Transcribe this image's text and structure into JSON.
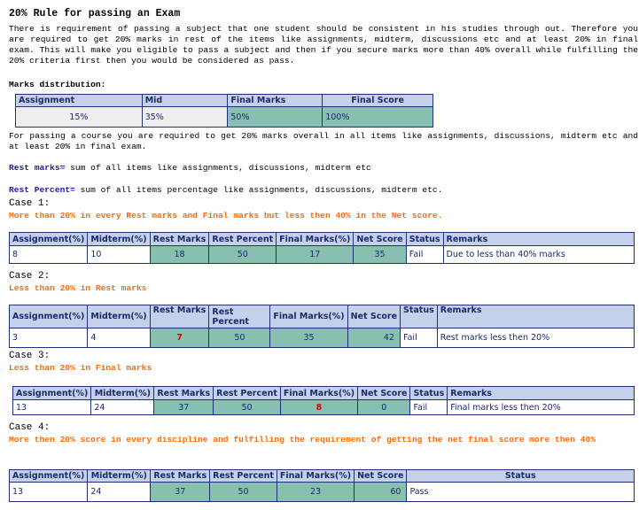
{
  "title": "20% Rule for passing an Exam",
  "intro": "There is requirement of passing a subject that one student should be consistent in his studies through out. Therefore you are required to get 20% marks in rest of the items like assignments, midterm, discussions etc and at least 20% in final exam. This will make you eligible to pass a subject and then if you secure marks more than 40% overall while fulfilling the 20% criteria first then you would be considered as pass.",
  "marks_heading": "Marks distribution:",
  "dist_table": {
    "headers": [
      "Assignment",
      "Mid",
      "Final Marks",
      "Final Score"
    ],
    "values": [
      "15%",
      "35%",
      "50%",
      "100%"
    ]
  },
  "passing_text": "For passing a course you are required to get 20% marks overall in all items like assignments, discussions, midterm etc and at least 20% in final exam.",
  "rest_marks_label": "Rest marks=",
  "rest_marks_text": " sum of all items like assignments, discussions, midterm etc",
  "rest_percent_label": "Rest Percent=",
  "rest_percent_text": " sum of all items percentage like assignments, discussions, midterm etc.",
  "cases": [
    {
      "title": "Case 1:",
      "subtitle": "More than 20% in every Rest marks and Final marks but less then 40% in the Net score.",
      "headers": [
        "Assignment(%)",
        "Midterm(%)",
        "Rest Marks",
        "Rest Percent",
        "Final Marks(%)",
        "Net Score",
        "Status",
        "Remarks"
      ],
      "row": [
        "8",
        "10",
        "18",
        "50",
        "17",
        "35",
        "Fail",
        "Due to less than 40% marks"
      ]
    },
    {
      "title": "Case 2:",
      "subtitle": "Less than 20% in Rest marks",
      "headers": [
        "Assignment(%)",
        "Midterm(%)",
        "Rest Marks",
        "Rest Percent",
        "Final Marks(%)",
        "Net Score",
        "Status",
        "Remarks"
      ],
      "row": [
        "3",
        "4",
        "7",
        "50",
        "35",
        "42",
        "Fail",
        "Rest marks less then 20%"
      ]
    },
    {
      "title": "Case 3:",
      "subtitle": "Less than 20% in Final marks",
      "headers": [
        "Assignment(%)",
        "Midterm(%)",
        "Rest Marks",
        "Rest Percent",
        "Final Marks(%)",
        "Net Score",
        "Status",
        "Remarks"
      ],
      "row": [
        "13",
        "24",
        "37",
        "50",
        "8",
        "0",
        "Fail",
        "Final marks less then 20%"
      ]
    },
    {
      "title": "Case 4:",
      "subtitle": "More then 20% score in every discipline and fulfilling the requirement of getting the net final score more then 40%",
      "headers": [
        "Assignment(%)",
        "Midterm(%)",
        "Rest Marks",
        "Rest Percent",
        "Final Marks(%)",
        "Net Score",
        "Status"
      ],
      "row": [
        "13",
        "24",
        "37",
        "50",
        "23",
        "60",
        "Pass"
      ]
    }
  ]
}
